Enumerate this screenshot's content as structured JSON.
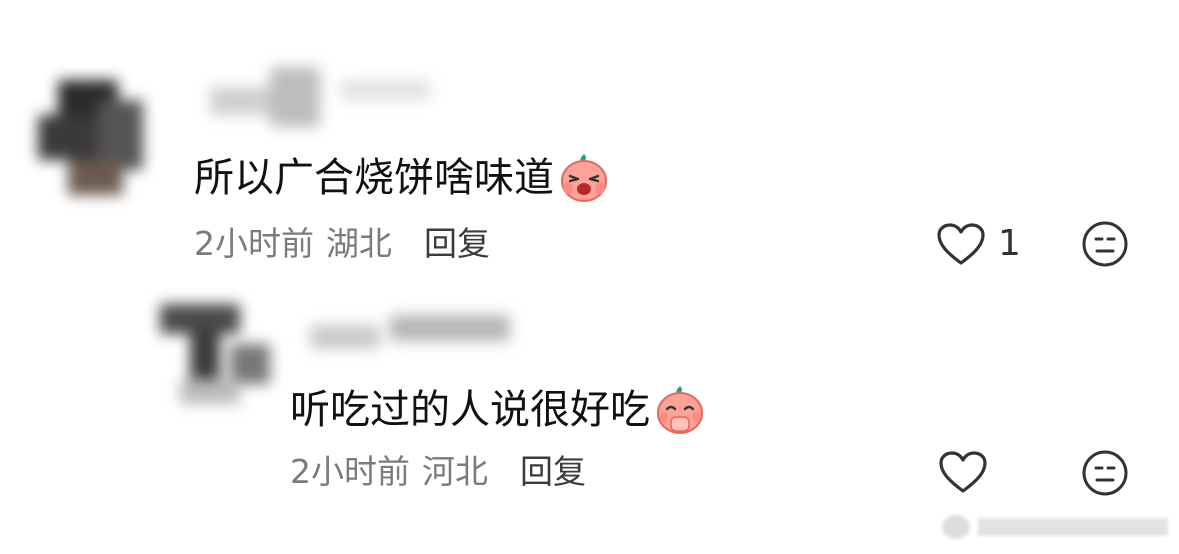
{
  "comments": [
    {
      "text": "所以广合烧饼啥味道",
      "emoji": "shocked-peach-emoji",
      "time": "2小时前",
      "location": "湖北",
      "reply_label": "回复",
      "likes": "1"
    },
    {
      "text": "听吃过的人说很好吃",
      "emoji": "praying-peach-emoji",
      "time": "2小时前",
      "location": "河北",
      "reply_label": "回复",
      "likes": ""
    }
  ],
  "icons": {
    "like": "heart-outline-icon",
    "dislike": "neutral-face-icon"
  },
  "colors": {
    "text": "#111111",
    "meta": "#7b7b7b",
    "reply": "#3b3b3b",
    "emoji_face": "#ff9a8f",
    "emoji_leaf": "#1fa37a"
  }
}
